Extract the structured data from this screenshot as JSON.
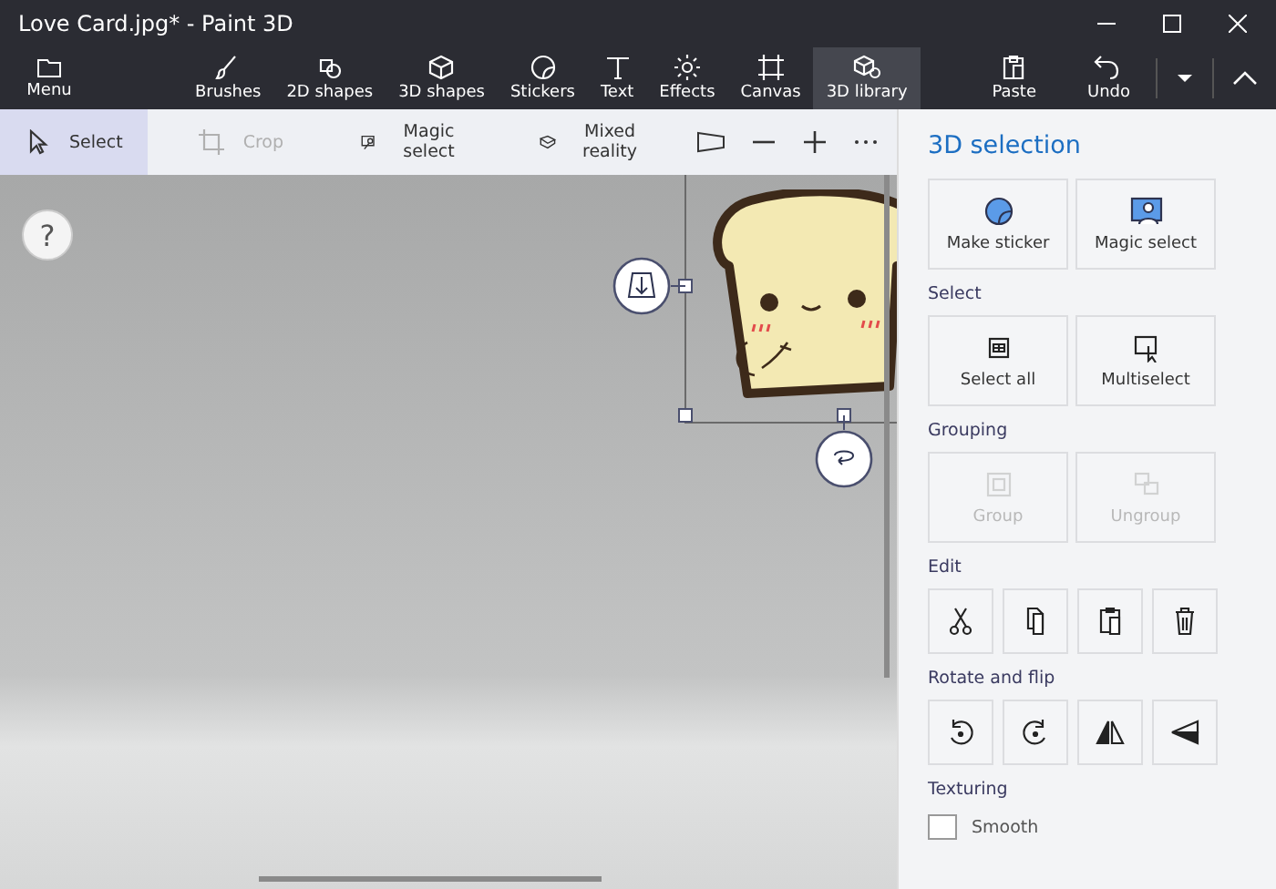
{
  "window": {
    "title": "Love Card.jpg* - Paint 3D"
  },
  "menu": {
    "label": "Menu"
  },
  "tabs": [
    {
      "label": "Brushes",
      "selected": false
    },
    {
      "label": "2D shapes",
      "selected": false
    },
    {
      "label": "3D shapes",
      "selected": false
    },
    {
      "label": "Stickers",
      "selected": false
    },
    {
      "label": "Text",
      "selected": false
    },
    {
      "label": "Effects",
      "selected": false
    },
    {
      "label": "Canvas",
      "selected": false
    },
    {
      "label": "3D library",
      "selected": true
    }
  ],
  "actions": [
    {
      "label": "Paste"
    },
    {
      "label": "Undo"
    }
  ],
  "tools": [
    {
      "label": "Select",
      "selected": true,
      "disabled": false
    },
    {
      "label": "Crop",
      "selected": false,
      "disabled": true
    },
    {
      "label": "Magic select",
      "selected": false,
      "disabled": false
    },
    {
      "label": "Mixed reality",
      "selected": false,
      "disabled": false
    }
  ],
  "panel": {
    "title": "3D selection",
    "sections": [
      {
        "buttons": [
          {
            "label": "Make sticker",
            "disabled": false
          },
          {
            "label": "Magic select",
            "disabled": false
          }
        ]
      },
      {
        "heading": "Select",
        "buttons": [
          {
            "label": "Select all",
            "disabled": false
          },
          {
            "label": "Multiselect",
            "disabled": false
          }
        ]
      },
      {
        "heading": "Grouping",
        "buttons": [
          {
            "label": "Group",
            "disabled": true
          },
          {
            "label": "Ungroup",
            "disabled": true
          }
        ]
      },
      {
        "heading": "Edit",
        "buttons": [
          {
            "disabled": false
          },
          {
            "disabled": false
          },
          {
            "disabled": false
          },
          {
            "disabled": false
          }
        ]
      },
      {
        "heading": "Rotate and flip",
        "buttons": [
          {
            "disabled": false
          },
          {
            "disabled": false
          },
          {
            "disabled": false
          },
          {
            "disabled": false
          }
        ]
      }
    ],
    "texturing": {
      "heading": "Texturing",
      "option": "Smooth",
      "checked": false
    }
  },
  "help": {
    "label": "?"
  }
}
